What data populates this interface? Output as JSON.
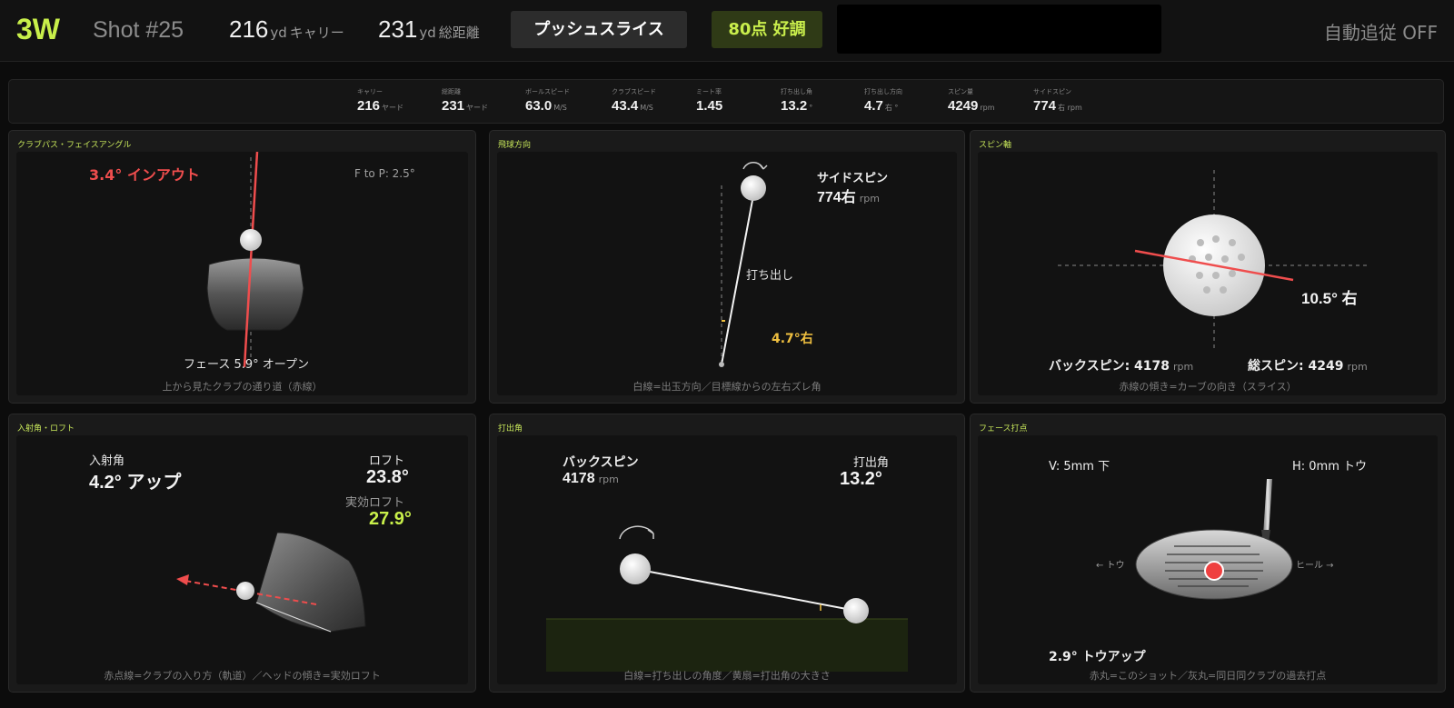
{
  "header": {
    "club": "3W",
    "shot": "Shot #25",
    "carry_value": "216",
    "carry_unit": "yd",
    "carry_label": "キャリー",
    "total_value": "231",
    "total_unit": "yd",
    "total_label": "総距離",
    "shot_type": "プッシュスライス",
    "score": "80点 好調",
    "auto_follow": "自動追従 OFF"
  },
  "stats": [
    {
      "label": "キャリー",
      "value": "216",
      "unit": "ヤード"
    },
    {
      "label": "総距離",
      "value": "231",
      "unit": "ヤード"
    },
    {
      "label": "ボールスピード",
      "value": "63.0",
      "unit": "M/S"
    },
    {
      "label": "クラブスピード",
      "value": "43.4",
      "unit": "M/S"
    },
    {
      "label": "ミート率",
      "value": "1.45",
      "unit": ""
    },
    {
      "label": "打ち出し角",
      "value": "13.2",
      "unit": "°"
    },
    {
      "label": "打ち出し方向",
      "value": "4.7",
      "unit": "右 °"
    },
    {
      "label": "スピン量",
      "value": "4249",
      "unit": "rpm"
    },
    {
      "label": "サイドスピン",
      "value": "774",
      "unit": "右 rpm"
    }
  ],
  "panels": {
    "club_path": {
      "title": "クラブパス・フェイスアングル",
      "path_label": "3.4° インアウト",
      "ftop": "F to P: 2.5°",
      "face_label": "フェース 5.9° オープン",
      "caption": "上から見たクラブの通り道（赤線）",
      "path_deg": 3.4,
      "face_deg": 5.9
    },
    "direction": {
      "title": "飛球方向",
      "sidespin_label": "サイドスピン",
      "sidespin_value": "774右",
      "rpm": "rpm",
      "launch_label": "打ち出し",
      "angle_label": "4.7°右",
      "caption": "白線=出玉方向／目標線からの左右ズレ角",
      "launch_dir_deg": 4.7
    },
    "spin_axis": {
      "title": "スピン軸",
      "axis_label": "10.5° 右",
      "backspin_label": "バックスピン: 4178",
      "total_label": "総スピン: 4249",
      "rpm": "rpm",
      "caption": "赤線の傾き=カーブの向き（スライス）",
      "axis_deg": 10.5
    },
    "attack": {
      "title": "入射角・ロフト",
      "attack_label": "入射角",
      "attack_value": "4.2° アップ",
      "loft_label": "ロフト",
      "loft_value": "23.8°",
      "eff_loft_label": "実効ロフト",
      "eff_loft_value": "27.9°",
      "caption": "赤点線=クラブの入り方（軌道）／ヘッドの傾き=実効ロフト"
    },
    "launch": {
      "title": "打出角",
      "backspin_label": "バックスピン",
      "backspin_value": "4178",
      "rpm": "rpm",
      "launch_label": "打出角",
      "launch_value": "13.2°",
      "caption": "白線=打ち出しの角度／黄扇=打出角の大きさ",
      "launch_deg": 13.2
    },
    "impact": {
      "title": "フェース打点",
      "v_label": "V: 5mm 下",
      "h_label": "H: 0mm トウ",
      "toe_label": "← トウ",
      "heel_label": "ヒール →",
      "toe_up": "2.9° トウアップ",
      "caption": "赤丸=このショット／灰丸=同日同クラブの過去打点"
    }
  },
  "colors": {
    "accent": "#c8ef4a",
    "red": "#f05050",
    "yellow": "#f0c040",
    "panel_bg": "#1a1a1a"
  }
}
